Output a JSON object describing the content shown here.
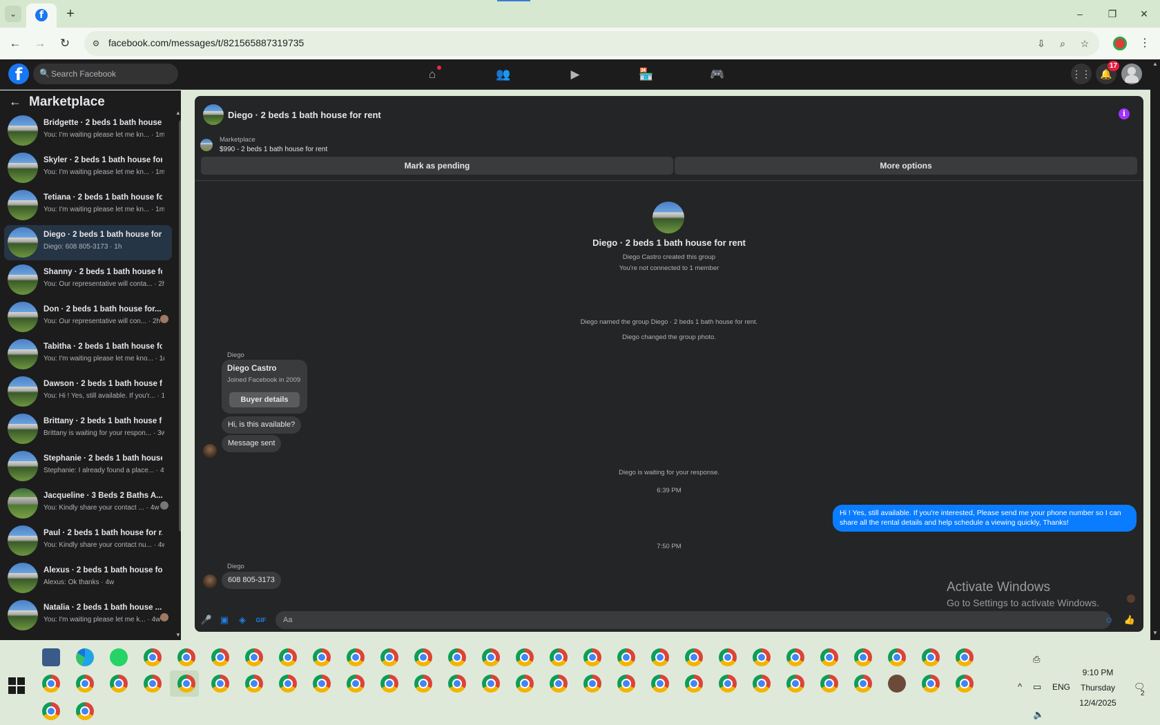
{
  "browser": {
    "url": "facebook.com/messages/t/821565887319735",
    "new_tab_symbol": "+",
    "controls": {
      "minimize": "–",
      "restore": "❐",
      "close": "✕"
    }
  },
  "facebook": {
    "logo": "f",
    "search_placeholder": "Search Facebook",
    "notifications_count": "17"
  },
  "sidebar": {
    "title": "Marketplace",
    "conversations": [
      {
        "title": "Bridgette · 2 beds 1 bath house ...",
        "snippet": "You: I'm waiting please let me kn... · 1m",
        "active": false
      },
      {
        "title": "Skyler · 2 beds 1 bath house for...",
        "snippet": "You: I'm waiting please let me kn... · 1m",
        "active": false
      },
      {
        "title": "Tetiana · 2 beds 1 bath house fo...",
        "snippet": "You: I'm waiting please let me kn... · 1m",
        "active": false
      },
      {
        "title": "Diego · 2 beds 1 bath house for ...",
        "snippet": "Diego: 608 805-3173 · 1h",
        "active": true
      },
      {
        "title": "Shanny · 2 beds 1 bath house fo...",
        "snippet": "You: Our representative will conta... · 2h",
        "active": false
      },
      {
        "title": "Don · 2 beds 1 bath house for...",
        "snippet": "You: Our representative will con... · 2h",
        "active": false
      },
      {
        "title": "Tabitha · 2 beds 1 bath house fo...",
        "snippet": "You: I'm waiting please let me kno... · 1d",
        "active": false
      },
      {
        "title": "Dawson · 2 beds 1 bath house f...",
        "snippet": "You: Hi ! Yes, still available. If you'r... · 1d",
        "active": false
      },
      {
        "title": "Brittany · 2 beds 1 bath house f...",
        "snippet": "Brittany is waiting for your respon... · 3w",
        "active": false
      },
      {
        "title": "Stephanie · 2 beds 1 bath house...",
        "snippet": "Stephanie: I already found a place... · 4w",
        "active": false
      },
      {
        "title": "Jacqueline · 3 Beds 2 Baths A...",
        "snippet": "You: Kindly share your contact ... · 4w",
        "active": false
      },
      {
        "title": "Paul · 2 beds 1 bath house for r...",
        "snippet": "You: Kindly share your contact nu... · 4w",
        "active": false
      },
      {
        "title": "Alexus · 2 beds 1 bath house for...",
        "snippet": "Alexus: Ok thanks · 4w",
        "active": false
      },
      {
        "title": "Natalia · 2 beds 1 bath house ...",
        "snippet": "You: I'm waiting please let me k... · 4w",
        "active": false
      }
    ]
  },
  "conversation": {
    "title": "Diego · 2 beds 1 bath house for rent",
    "listing_label": "Marketplace",
    "listing_price_title": "$990 - 2 beds 1 bath house for rent",
    "mark_pending_label": "Mark as pending",
    "more_options_label": "More options",
    "group_title": "Diego · 2 beds 1 bath house for rent",
    "created_text": "Diego Castro created this group",
    "not_connected_text": "You're not connected to 1 member",
    "event_named": "Diego named the group Diego · 2 beds 1 bath house for rent.",
    "event_photo": "Diego changed the group photo.",
    "sender_name": "Diego",
    "buyer_card": {
      "name": "Diego Castro",
      "joined": "Joined Facebook in 2009",
      "button": "Buyer details"
    },
    "msg_available": "Hi, is this available?",
    "msg_sent": "Message sent",
    "waiting_text": "Diego is waiting for your response.",
    "time_1": "6:39 PM",
    "outgoing_msg": "Hi ! Yes, still available. If you're interested, Please send me your phone number so I can share all the rental details and help schedule a viewing quickly, Thanks!",
    "time_2": "7:50 PM",
    "msg_phone": "608 805-3173",
    "composer_placeholder": "Aa"
  },
  "watermark": {
    "line1": "Activate Windows",
    "line2": "Go to Settings to activate Windows."
  },
  "taskbar": {
    "time": "9:10 PM",
    "day": "Thursday",
    "date": "12/4/2025",
    "language": "ENG",
    "notification_count": "2"
  },
  "colors": {
    "fb_blue": "#1877f2",
    "bubble_blue": "#0a7cff",
    "panel_dark": "#242526",
    "info_purple": "#a033ff"
  }
}
